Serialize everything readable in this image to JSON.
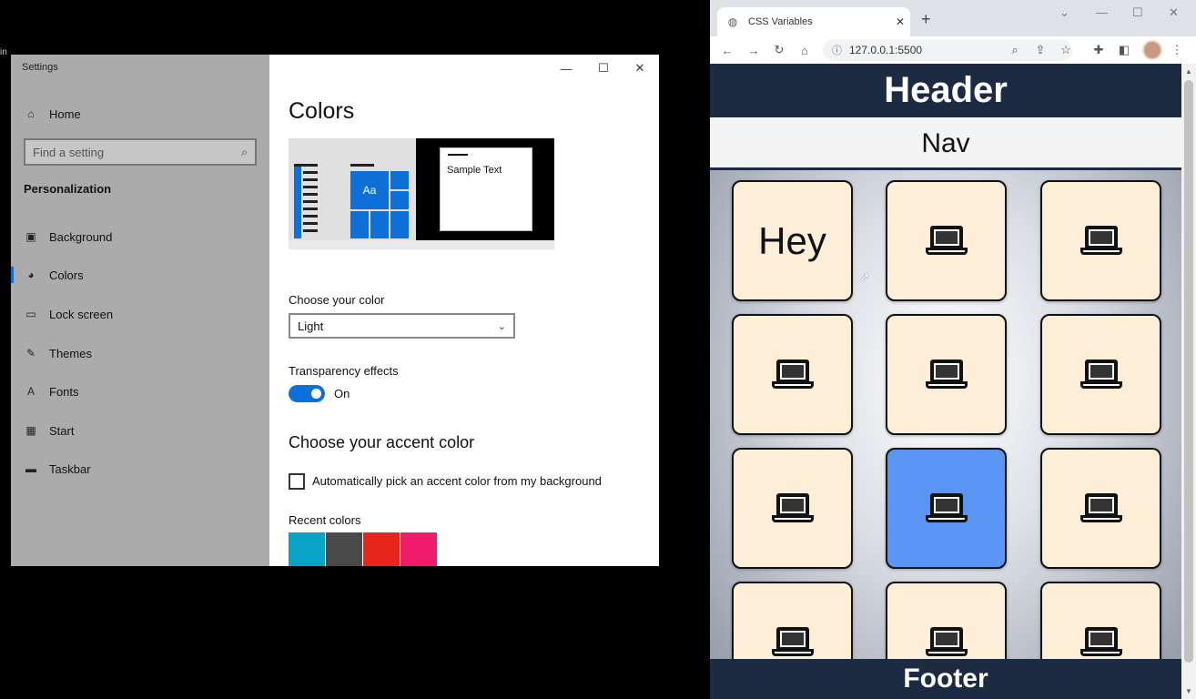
{
  "desktop": {
    "edge_text": "in"
  },
  "settings": {
    "window_title": "Settings",
    "window_controls": {
      "minimize": "—",
      "maximize": "☐",
      "close": "✕"
    },
    "sidebar": {
      "home": {
        "icon": "home-icon",
        "label": "Home"
      },
      "search_placeholder": "Find a setting",
      "section": "Personalization",
      "items": [
        {
          "icon": "background-icon",
          "label": "Background"
        },
        {
          "icon": "colors-icon",
          "label": "Colors",
          "active": true
        },
        {
          "icon": "lock-screen-icon",
          "label": "Lock screen"
        },
        {
          "icon": "themes-icon",
          "label": "Themes"
        },
        {
          "icon": "fonts-icon",
          "label": "Fonts"
        },
        {
          "icon": "start-icon",
          "label": "Start"
        },
        {
          "icon": "taskbar-icon",
          "label": "Taskbar"
        }
      ]
    },
    "content": {
      "title": "Colors",
      "preview_sample_text": "Sample Text",
      "preview_tile_text": "Aa",
      "choose_color_label": "Choose your color",
      "choose_color_value": "Light",
      "transparency_label": "Transparency effects",
      "transparency_state": "On",
      "accent_heading": "Choose your accent color",
      "auto_pick_label": "Automatically pick an accent color from my background",
      "recent_colors_label": "Recent colors",
      "recent_colors": [
        "#0aa3c8",
        "#4a4a4a",
        "#e8251d",
        "#ef1c6a"
      ],
      "accent_color": "#0f6fd8"
    }
  },
  "browser": {
    "tab_title": "CSS Variables",
    "url": "127.0.0.1:5500",
    "page": {
      "header": "Header",
      "nav": "Nav",
      "footer": "Footer",
      "cards": [
        {
          "text": "Hey",
          "icon": null,
          "highlight": false
        },
        {
          "text": "",
          "icon": "laptop-icon",
          "highlight": false
        },
        {
          "text": "",
          "icon": "laptop-icon",
          "highlight": false
        },
        {
          "text": "",
          "icon": "laptop-icon",
          "highlight": false
        },
        {
          "text": "",
          "icon": "laptop-icon",
          "highlight": false
        },
        {
          "text": "",
          "icon": "laptop-icon",
          "highlight": false
        },
        {
          "text": "",
          "icon": "laptop-icon",
          "highlight": false
        },
        {
          "text": "",
          "icon": "laptop-icon",
          "highlight": true
        },
        {
          "text": "",
          "icon": "laptop-icon",
          "highlight": false
        },
        {
          "text": "",
          "icon": "laptop-icon",
          "highlight": false
        },
        {
          "text": "",
          "icon": "laptop-icon",
          "highlight": false
        },
        {
          "text": "",
          "icon": "laptop-icon",
          "highlight": false
        }
      ],
      "colors": {
        "dark": "#1c2b42",
        "card": "#fdeed8",
        "card_highlight": "#5b95f3"
      }
    }
  }
}
